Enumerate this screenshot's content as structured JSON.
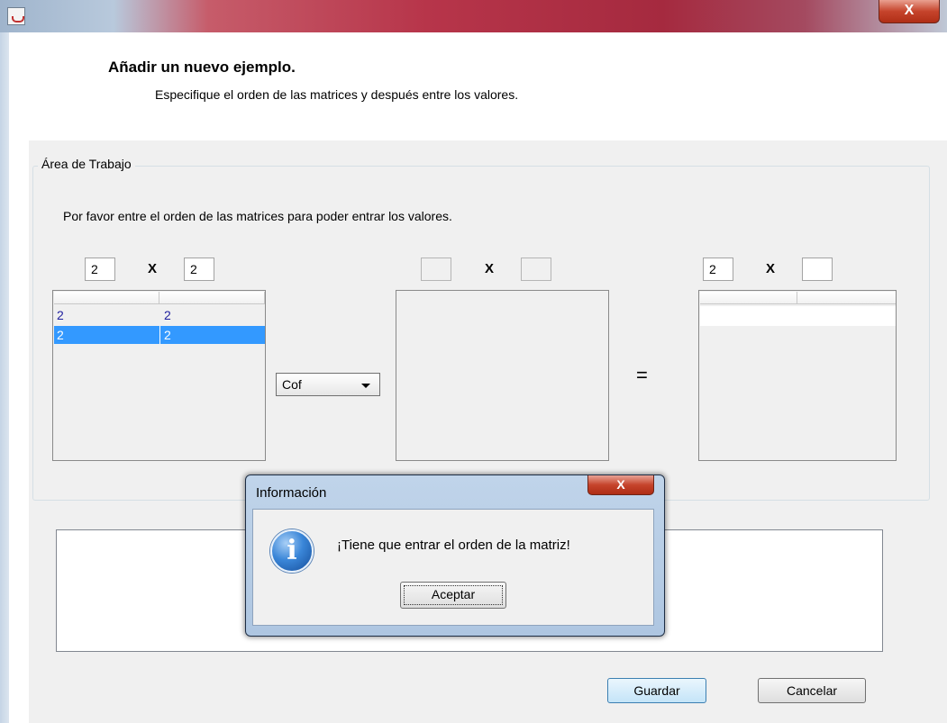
{
  "window": {
    "close_glyph": "X",
    "app_icon": "java-icon"
  },
  "header": {
    "title": "Añadir un nuevo ejemplo.",
    "subtitle": "Especifique el orden de las matrices y después entre los valores."
  },
  "workarea": {
    "legend": "Área de Trabajo",
    "instructions": "Por favor entre el orden de las matrices para poder entrar los valores.",
    "matrix_a": {
      "rows": "2",
      "cols": "2",
      "x_label": "X",
      "table": [
        [
          "2",
          "2"
        ],
        [
          "2",
          "2"
        ]
      ],
      "selected_row": 1
    },
    "operation": {
      "selected": "Cof"
    },
    "matrix_b": {
      "rows": "",
      "cols": "",
      "x_label": "X"
    },
    "equals": "=",
    "matrix_c": {
      "rows": "2",
      "cols": "",
      "x_label": "X"
    }
  },
  "buttons": {
    "save": "Guardar",
    "cancel": "Cancelar"
  },
  "dialog": {
    "title": "Información",
    "close_glyph": "X",
    "icon": "info-icon",
    "icon_glyph": "i",
    "message": "¡Tiene que entrar el orden de la matriz!",
    "ok": "Aceptar"
  }
}
